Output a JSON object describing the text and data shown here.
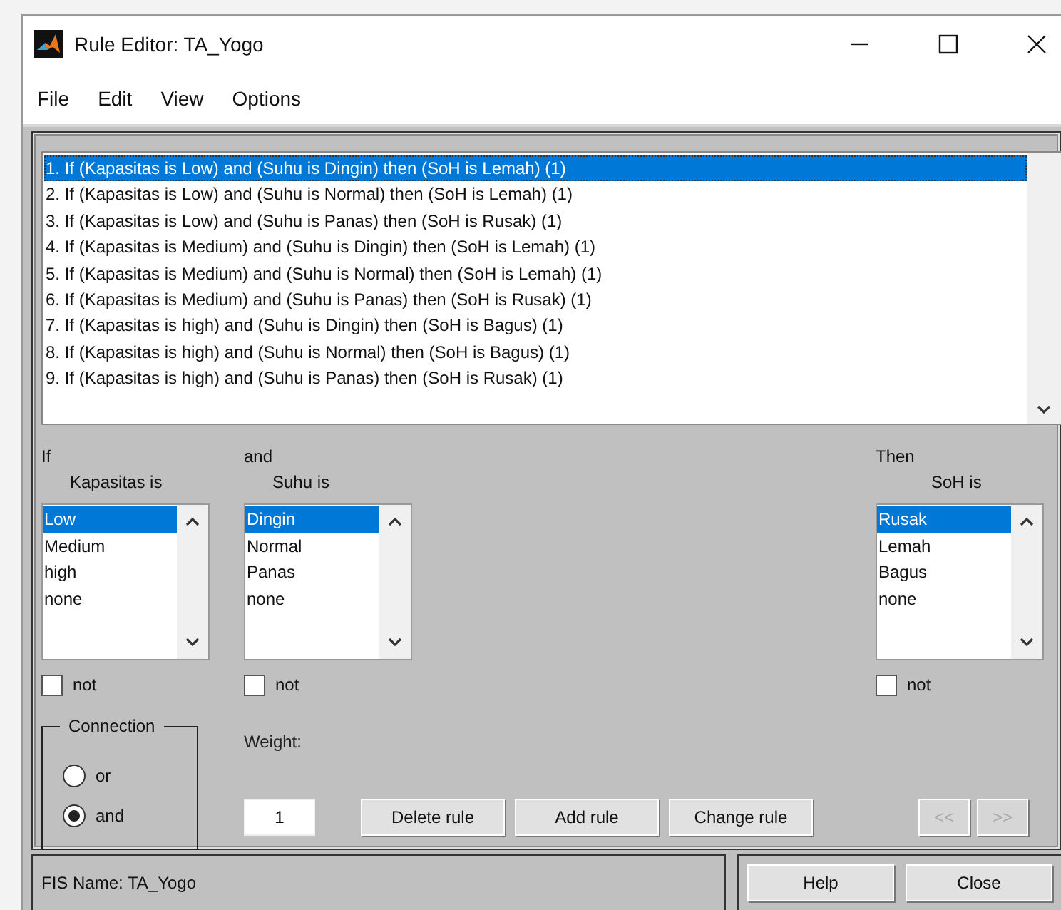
{
  "window": {
    "title": "Rule Editor: TA_Yogo"
  },
  "menu": [
    "File",
    "Edit",
    "View",
    "Options"
  ],
  "rules": [
    {
      "text": "1. If (Kapasitas is Low) and (Suhu is Dingin) then (SoH is Lemah) (1)",
      "selected": true
    },
    {
      "text": "2. If (Kapasitas is Low) and (Suhu is Normal) then (SoH is Lemah) (1)",
      "selected": false
    },
    {
      "text": "3. If (Kapasitas is Low) and (Suhu is Panas) then (SoH is Rusak) (1)",
      "selected": false
    },
    {
      "text": "4. If (Kapasitas is Medium) and (Suhu is Dingin) then (SoH is Lemah) (1)",
      "selected": false
    },
    {
      "text": "5. If (Kapasitas is Medium) and (Suhu is Normal) then (SoH is Lemah) (1)",
      "selected": false
    },
    {
      "text": "6. If (Kapasitas is Medium) and (Suhu is Panas) then (SoH is Rusak) (1)",
      "selected": false
    },
    {
      "text": "7. If (Kapasitas is high) and (Suhu is Dingin) then (SoH is Bagus) (1)",
      "selected": false
    },
    {
      "text": "8. If (Kapasitas is high) and (Suhu is Normal) then (SoH is Bagus) (1)",
      "selected": false
    },
    {
      "text": "9. If (Kapasitas is high) and (Suhu is Panas) then (SoH is Rusak) (1)",
      "selected": false
    }
  ],
  "variables": [
    {
      "kind": "input",
      "prefix": "If",
      "heading": "Kapasitas is",
      "options": [
        {
          "label": "Low",
          "selected": true
        },
        {
          "label": "Medium",
          "selected": false
        },
        {
          "label": "high",
          "selected": false
        },
        {
          "label": "none",
          "selected": false
        }
      ],
      "not_label": "not",
      "not_checked": false
    },
    {
      "kind": "input",
      "prefix": "and",
      "heading": "Suhu is",
      "options": [
        {
          "label": "Dingin",
          "selected": true
        },
        {
          "label": "Normal",
          "selected": false
        },
        {
          "label": "Panas",
          "selected": false
        },
        {
          "label": "none",
          "selected": false
        }
      ],
      "not_label": "not",
      "not_checked": false
    },
    {
      "kind": "output",
      "prefix": "Then",
      "heading": "SoH is",
      "options": [
        {
          "label": "Rusak",
          "selected": true
        },
        {
          "label": "Lemah",
          "selected": false
        },
        {
          "label": "Bagus",
          "selected": false
        },
        {
          "label": "none",
          "selected": false
        }
      ],
      "not_label": "not",
      "not_checked": false
    }
  ],
  "connection": {
    "title": "Connection",
    "options": [
      {
        "label": "or",
        "selected": false
      },
      {
        "label": "and",
        "selected": true
      }
    ]
  },
  "weight": {
    "label": "Weight:",
    "value": "1"
  },
  "rule_buttons": [
    "Delete rule",
    "Add rule",
    "Change rule"
  ],
  "nav_buttons": [
    {
      "label": "<<",
      "disabled": true
    },
    {
      "label": ">>",
      "disabled": true
    }
  ],
  "status": "FIS Name: TA_Yogo",
  "footer_buttons": [
    "Help",
    "Close"
  ]
}
